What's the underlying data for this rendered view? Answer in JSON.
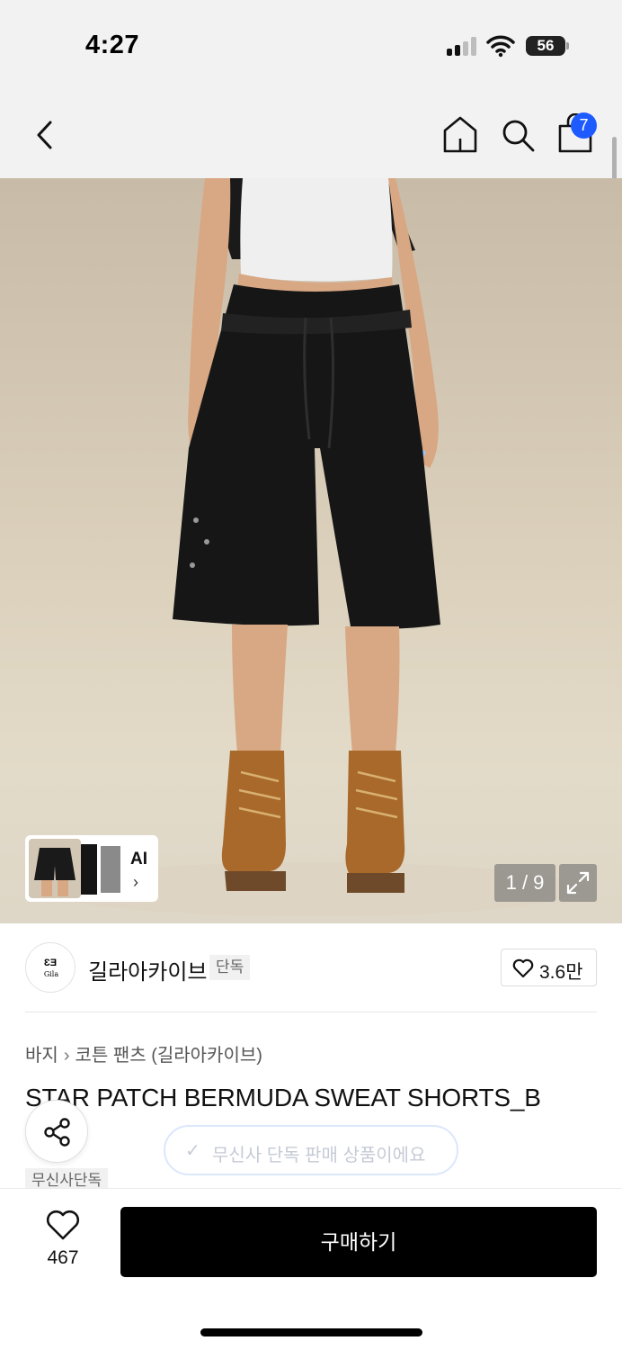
{
  "status_bar": {
    "time": "4:27",
    "battery": "56"
  },
  "nav": {
    "cart_count": "7"
  },
  "gallery": {
    "ai_label": "AI",
    "ai_chevron": "›",
    "page_indicator": "1 / 9"
  },
  "brand": {
    "name": "길라아카이브",
    "tag": "단독",
    "likes": "3.6만",
    "logo_text": "Gila"
  },
  "product": {
    "breadcrumb": [
      "바지",
      "코튼 팬츠 (길라아카이브)"
    ],
    "breadcrumb_separator": "›",
    "title": "STAR PATCH BERMUDA SWEAT SHORTS_B",
    "exclusive_notice": "무신사 단독 판매 상품이에요",
    "tag": "무신사단독"
  },
  "footer": {
    "like_count": "467",
    "buy_label": "구매하기"
  },
  "colors": {
    "accent_blue": "#1e5bff",
    "buy_button": "#000000"
  }
}
